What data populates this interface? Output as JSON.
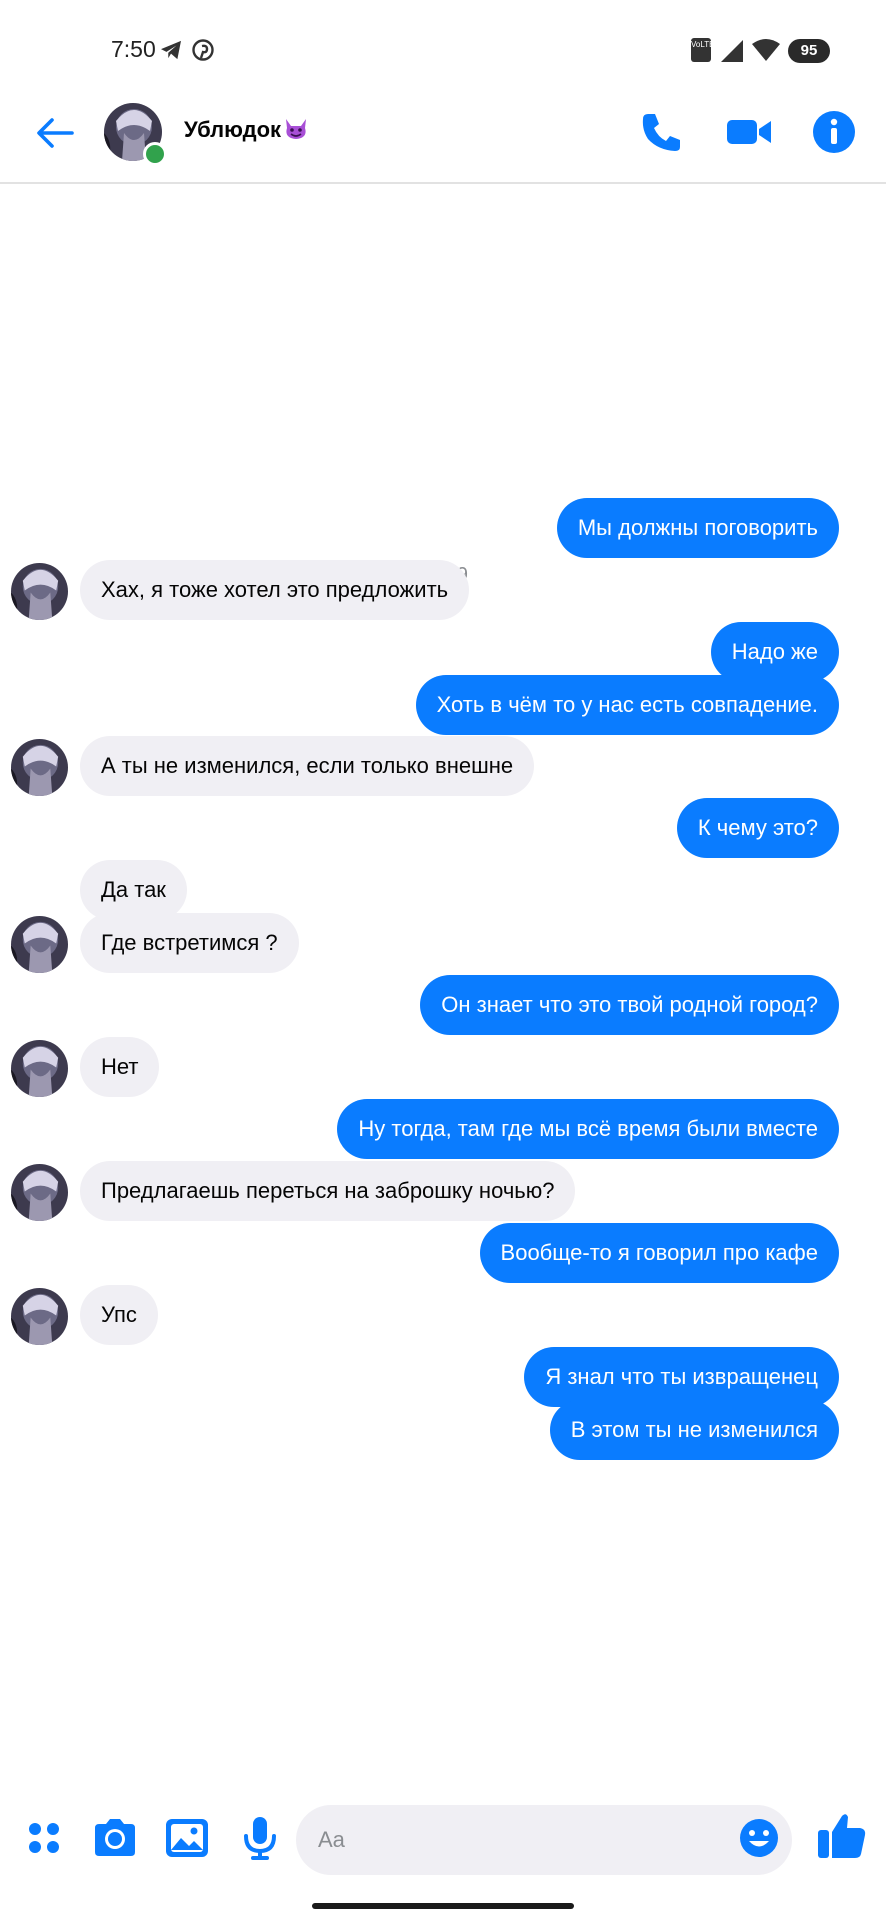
{
  "status_bar": {
    "time": "7:50",
    "network_badge": "VoLTE",
    "battery": "95",
    "icons": [
      "telegram-icon",
      "pinterest-icon",
      "volte-icon",
      "signal-icon",
      "wifi-icon",
      "battery-icon"
    ]
  },
  "header": {
    "contact_name": "Ублюдок",
    "emoji": "devil-emoji",
    "online": true,
    "accent": "#0a7cff",
    "buttons": [
      "back-icon",
      "phone-icon",
      "video-icon",
      "info-icon"
    ]
  },
  "chat": {
    "timestamp": "07:39",
    "messages": [
      {
        "from": "me",
        "text": "Мы должны поговорить"
      },
      {
        "from": "them",
        "text": "Хах, я тоже хотел это предложить"
      },
      {
        "from": "me",
        "text": "Надо же"
      },
      {
        "from": "me",
        "text": "Хоть в чём то у нас есть совпадение."
      },
      {
        "from": "them",
        "text": "А ты не изменился, если только внешне"
      },
      {
        "from": "me",
        "text": "К чему это?"
      },
      {
        "from": "them",
        "text": "Да так"
      },
      {
        "from": "them",
        "text": "Где встретимся ?"
      },
      {
        "from": "me",
        "text": "Он знает что это твой родной город?"
      },
      {
        "from": "them",
        "text": "Нет"
      },
      {
        "from": "me",
        "text": "Ну тогда, там где мы всё время были вместе"
      },
      {
        "from": "them",
        "text": "Предлагаешь переться на заброшку  ночью?"
      },
      {
        "from": "me",
        "text": "Вообще-то я говорил про кафе"
      },
      {
        "from": "them",
        "text": "Упс"
      },
      {
        "from": "me",
        "text": "Я знал что ты извращенец"
      },
      {
        "from": "me",
        "text": "В этом ты не изменился"
      }
    ]
  },
  "composer": {
    "placeholder": "Aa",
    "icons": [
      "apps-icon",
      "camera-icon",
      "gallery-icon",
      "microphone-icon",
      "emoji-icon",
      "like-icon"
    ]
  }
}
